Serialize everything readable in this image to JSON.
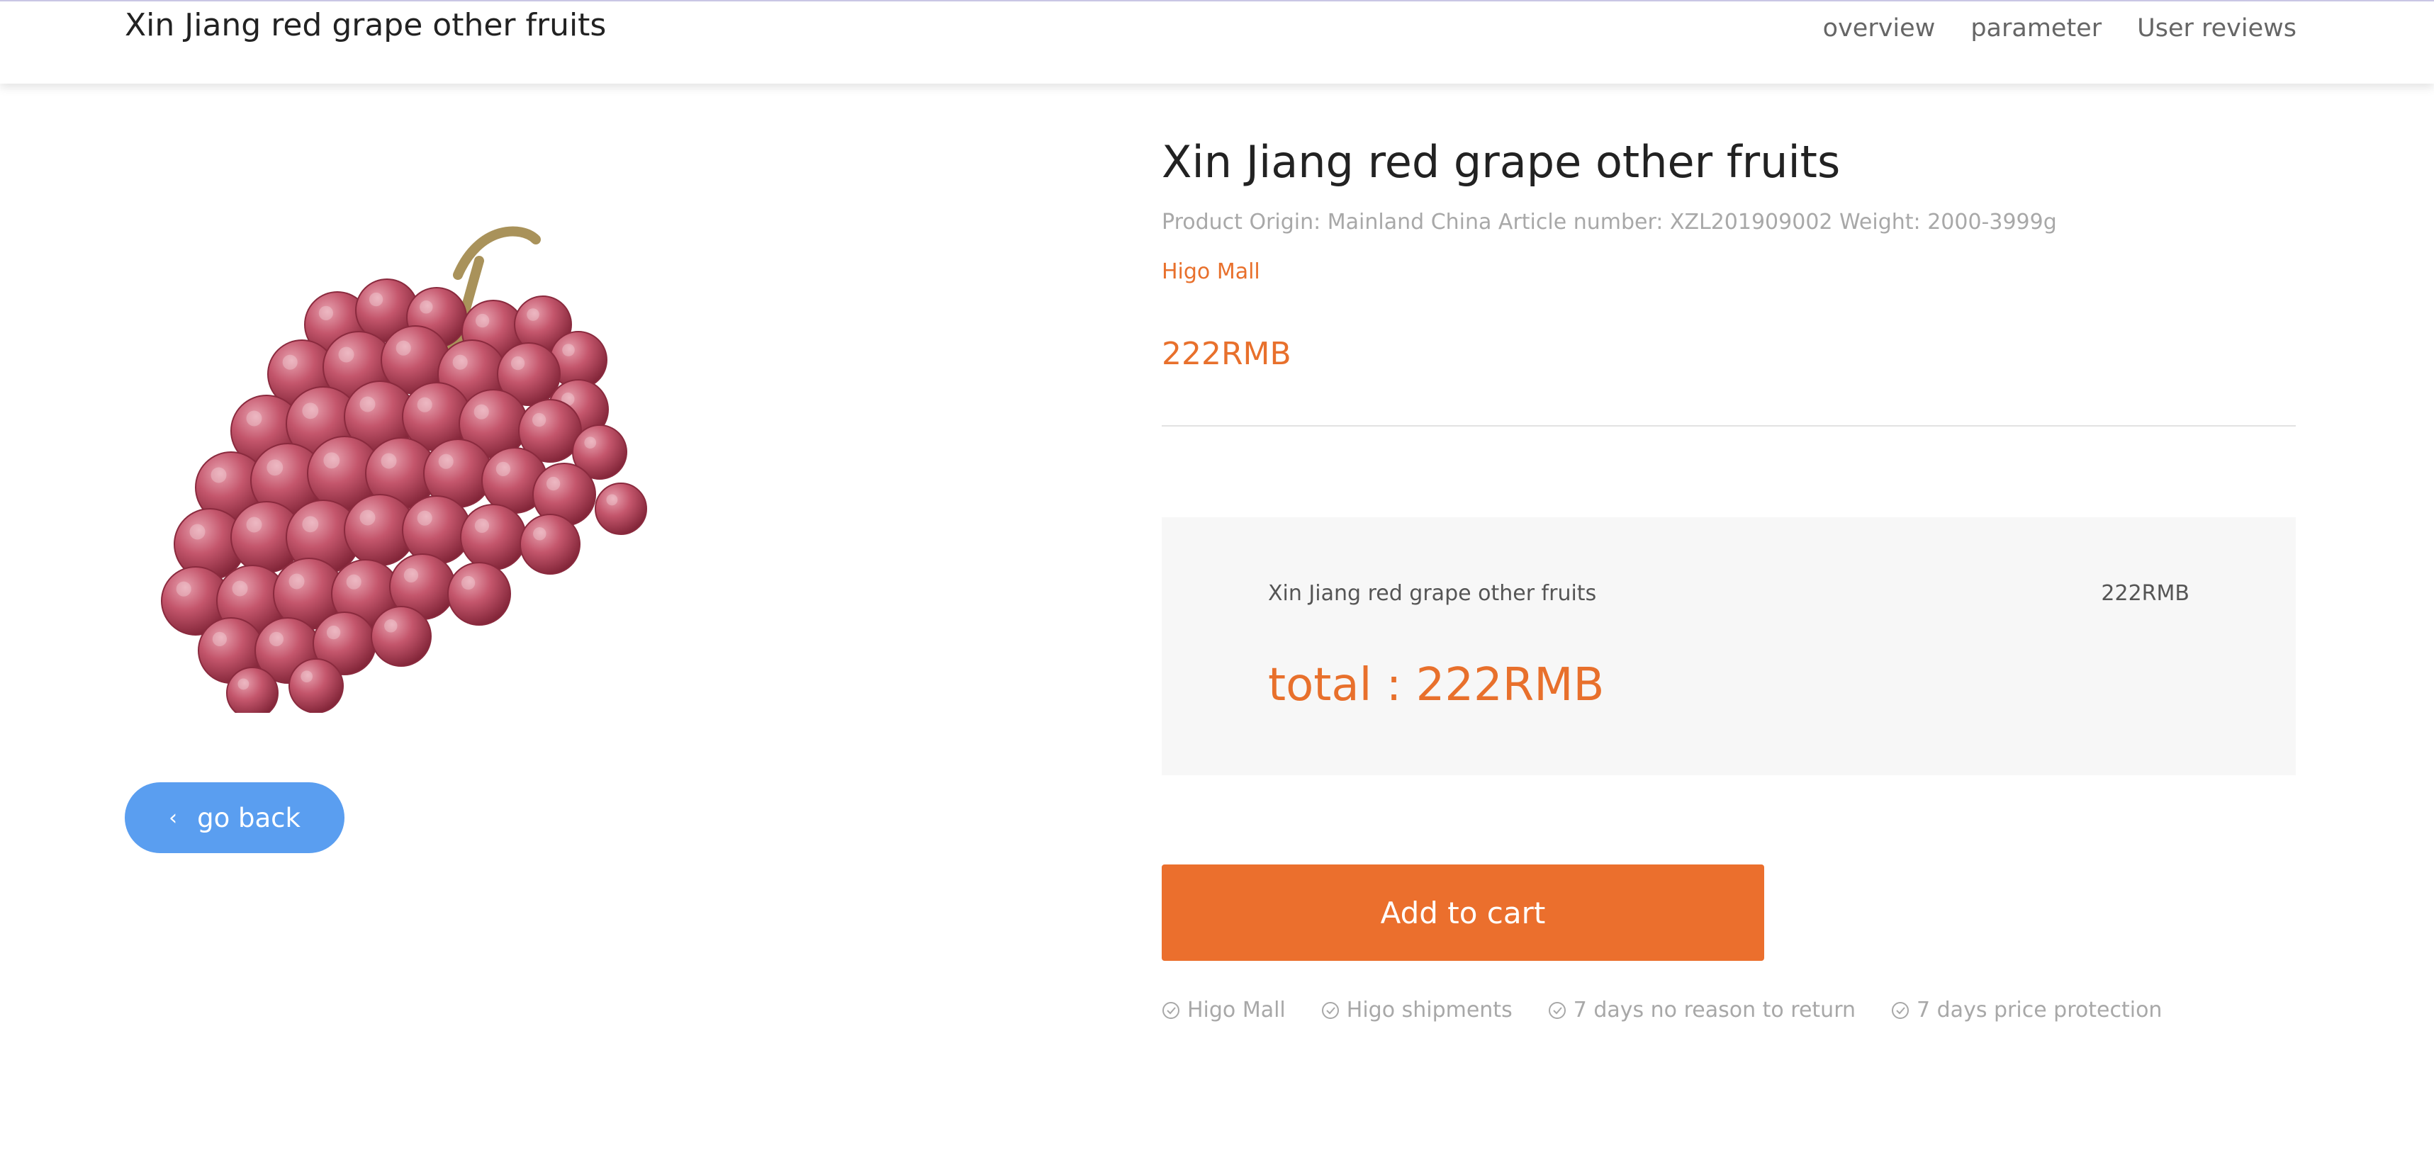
{
  "header": {
    "title": "Xin Jiang red grape other fruits",
    "nav": [
      "overview",
      "parameter",
      "User reviews"
    ]
  },
  "product": {
    "image_icon": "grape-bunch-image",
    "title": "Xin Jiang red grape other fruits",
    "meta": "Product Origin: Mainland China Article number: XZL201909002 Weight: 2000-3999g",
    "store": "Higo Mall",
    "price": "222RMB"
  },
  "summary": {
    "item_name": "Xin Jiang red grape other fruits",
    "item_price": "222RMB",
    "total": "total : 222RMB"
  },
  "actions": {
    "go_back": "go back",
    "add_to_cart": "Add to cart"
  },
  "badges": [
    "Higo Mall",
    "Higo shipments",
    "7 days no reason to return",
    "7 days price protection"
  ],
  "colors": {
    "accent": "#eb6f2d",
    "back_button": "#5a9ef0",
    "summary_bg": "#f7f7f7"
  }
}
